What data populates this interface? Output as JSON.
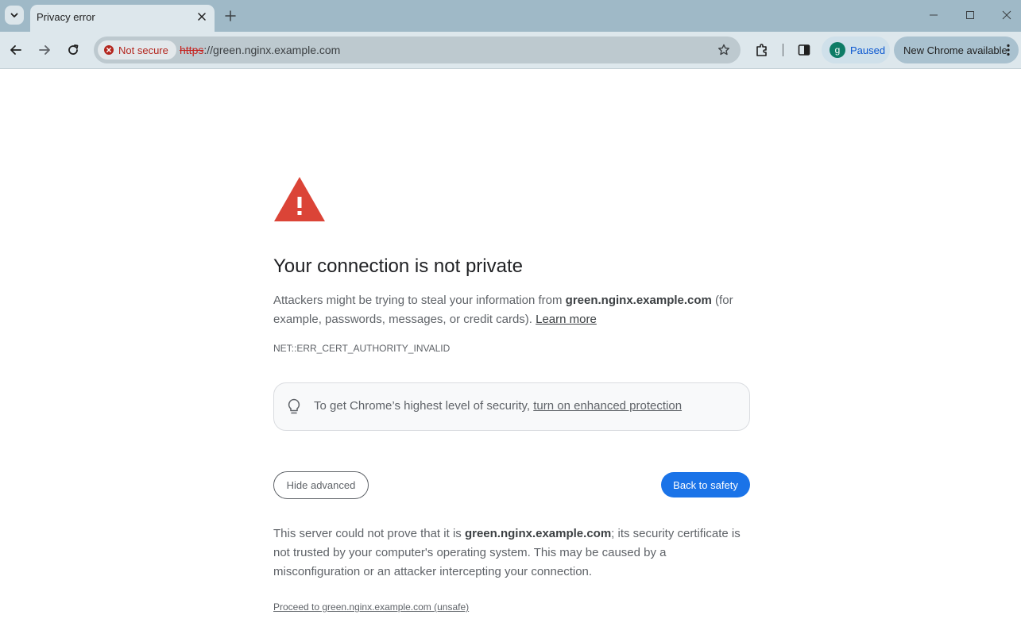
{
  "tab": {
    "title": "Privacy error"
  },
  "toolbar": {
    "security_chip": "Not secure",
    "url_scheme": "https",
    "url_rest": "://green.nginx.example.com",
    "profile_initial": "g",
    "profile_status": "Paused",
    "update_label": "New Chrome available"
  },
  "page": {
    "heading": "Your connection is not private",
    "intro_before": "Attackers might be trying to steal your information from ",
    "intro_host": "green.nginx.example.com",
    "intro_after": " (for example, passwords, messages, or credit cards). ",
    "learn_more": "Learn more",
    "error_code": "NET::ERR_CERT_AUTHORITY_INVALID",
    "enhanced_text": "To get Chrome’s highest level of security, ",
    "enhanced_link": "turn on enhanced protection",
    "hide_advanced": "Hide advanced",
    "back_to_safety": "Back to safety",
    "details_before": "This server could not prove that it is ",
    "details_host": "green.nginx.example.com",
    "details_after": "; its security certificate is not trusted by your computer's operating system. This may be caused by a misconfiguration or an attacker intercepting your connection.",
    "proceed_link": "Proceed to green.nginx.example.com (unsafe)"
  },
  "colors": {
    "warning_red": "#db4437",
    "primary_blue": "#1a73e8",
    "insecure_red": "#c5221f"
  }
}
